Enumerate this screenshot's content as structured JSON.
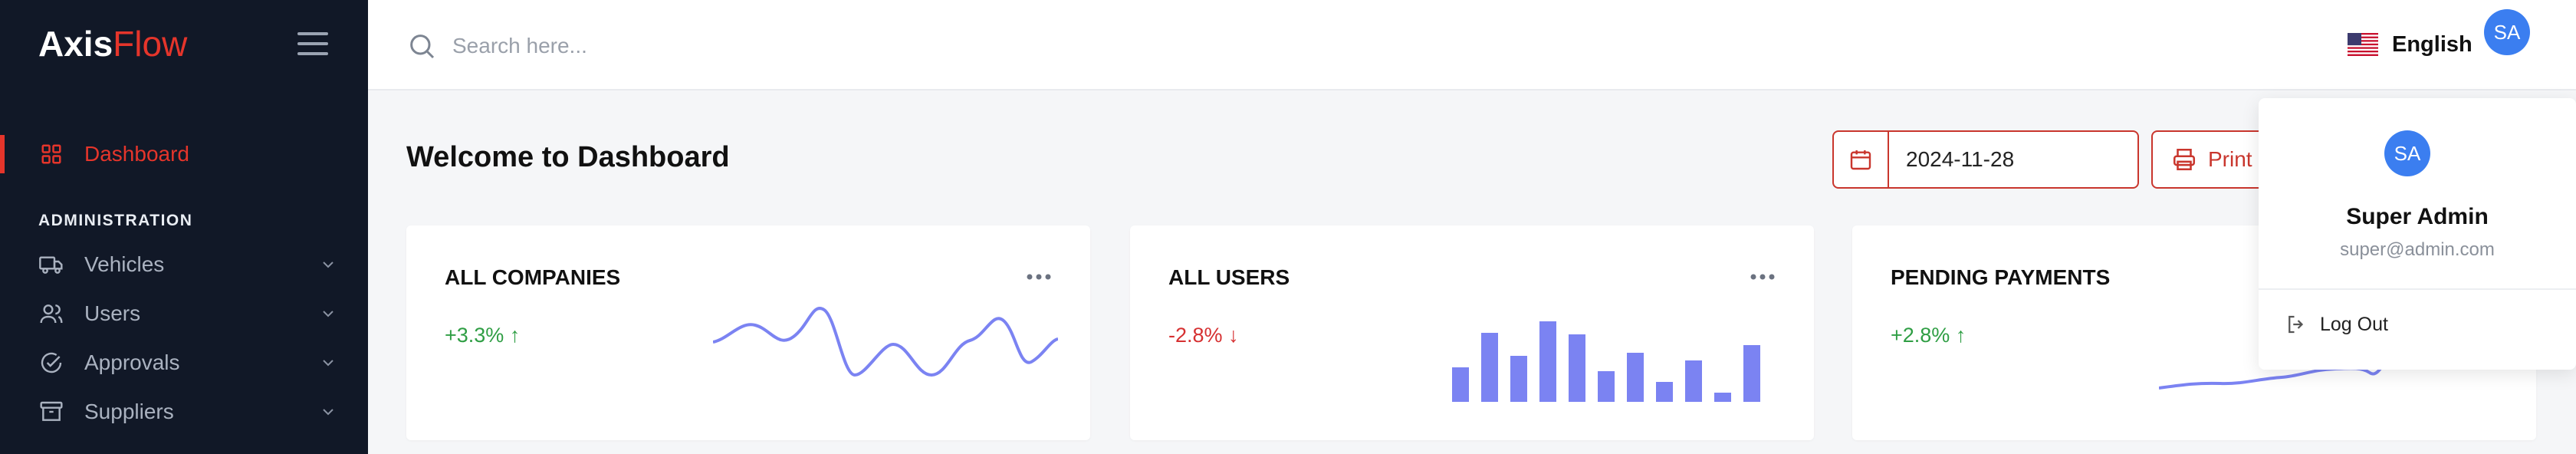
{
  "brand": {
    "name_part1": "Axis",
    "name_part2": "Flow"
  },
  "sidebar": {
    "dashboard_label": "Dashboard",
    "section_title": "ADMINISTRATION",
    "items": [
      {
        "label": "Vehicles",
        "icon": "truck-icon"
      },
      {
        "label": "Users",
        "icon": "users-icon"
      },
      {
        "label": "Approvals",
        "icon": "check-circle-icon"
      },
      {
        "label": "Suppliers",
        "icon": "archive-icon"
      }
    ]
  },
  "header": {
    "search_placeholder": "Search here...",
    "language": "English",
    "avatar_initials": "SA"
  },
  "main": {
    "title": "Welcome to Dashboard",
    "date_value": "2024-11-28",
    "print_label": "Print"
  },
  "cards": [
    {
      "title": "ALL COMPANIES",
      "change": "+3.3%",
      "trend": "up",
      "chart": "line"
    },
    {
      "title": "ALL USERS",
      "change": "-2.8%",
      "trend": "down",
      "chart": "bar"
    },
    {
      "title": "PENDING PAYMENTS",
      "change": "+2.8%",
      "trend": "up",
      "chart": "line"
    }
  ],
  "user_menu": {
    "initials": "SA",
    "name": "Super Admin",
    "email": "super@admin.com",
    "logout_label": "Log Out"
  },
  "colors": {
    "accent": "#e5352b",
    "sidebar_bg": "#111827",
    "chart": "#7b83f2",
    "up": "#2f9e44",
    "down": "#d63031",
    "avatar": "#3b7ef0"
  }
}
